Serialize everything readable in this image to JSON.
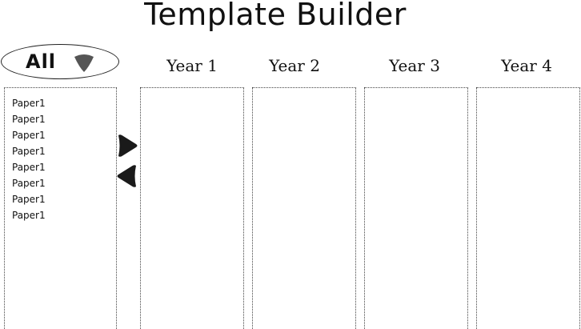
{
  "title": "Template Builder",
  "filter": {
    "selected": "All",
    "caret_icon": "chevron-down-icon",
    "caret_color": "#555555"
  },
  "source_list": {
    "items": [
      "Paper1",
      "Paper1",
      "Paper1",
      "Paper1",
      "Paper1",
      "Paper1",
      "Paper1",
      "Paper1"
    ]
  },
  "move_buttons": {
    "right_icon": "arrow-right-icon",
    "left_icon": "arrow-left-icon",
    "color": "#1a1a1a"
  },
  "years": [
    {
      "label": "Year 1"
    },
    {
      "label": "Year 2"
    },
    {
      "label": "Year 3"
    },
    {
      "label": "Year 4"
    }
  ]
}
